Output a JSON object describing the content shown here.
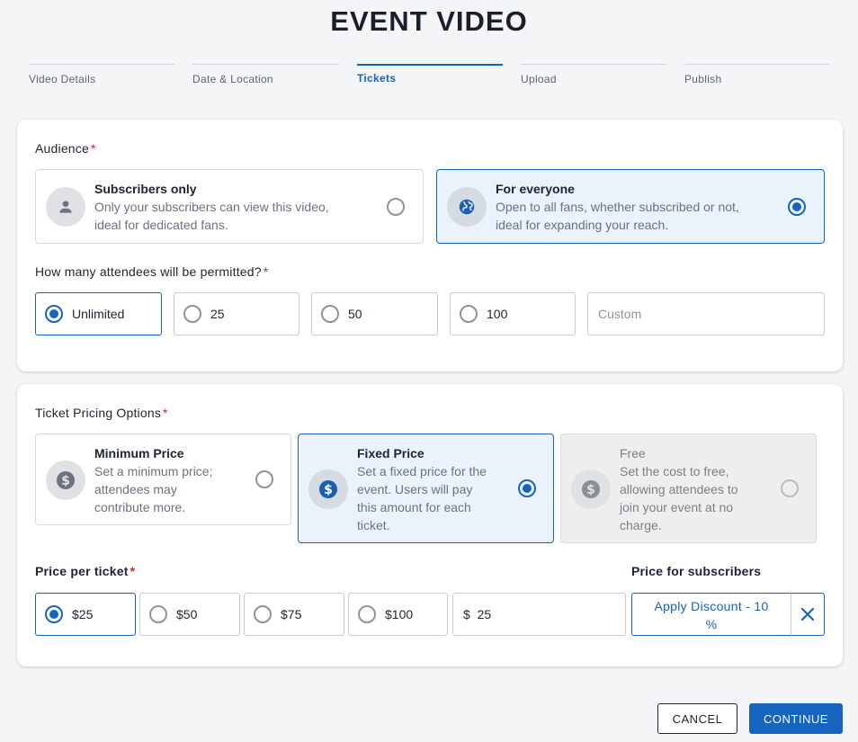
{
  "page": {
    "title": "EVENT VIDEO"
  },
  "steps": [
    {
      "label": "Video Details",
      "active": false
    },
    {
      "label": "Date & Location",
      "active": false
    },
    {
      "label": "Tickets",
      "active": true
    },
    {
      "label": "Upload",
      "active": false
    },
    {
      "label": "Publish",
      "active": false
    }
  ],
  "audience": {
    "label": "Audience",
    "required_mark": "*",
    "options": [
      {
        "title": "Subscribers only",
        "desc_line1": "Only your subscribers can view this video,",
        "desc_line2": "ideal for dedicated fans.",
        "icon": "person-icon",
        "selected": false
      },
      {
        "title": "For everyone",
        "desc_line1": "Open to all fans, whether subscribed or not,",
        "desc_line2": "ideal for expanding your reach.",
        "icon": "globe-icon",
        "selected": true
      }
    ]
  },
  "attendees": {
    "label": "How many attendees will be permitted?",
    "required_mark": "*",
    "options": [
      "Unlimited",
      "25",
      "50",
      "100"
    ],
    "selected": "Unlimited",
    "custom_placeholder": "Custom"
  },
  "pricing": {
    "label": "Ticket Pricing Options",
    "required_mark": "*",
    "options": [
      {
        "title": "Minimum Price",
        "desc_lines": [
          "Set a minimum price;",
          "attendees may",
          "contribute more."
        ],
        "icon": "dollar-icon",
        "selected": false,
        "disabled": false
      },
      {
        "title": "Fixed Price",
        "desc_lines": [
          "Set a fixed price for the",
          "event. Users will pay",
          "this amount for each",
          "ticket."
        ],
        "icon": "dollar-icon",
        "selected": true,
        "disabled": false
      },
      {
        "title": "Free",
        "desc_lines": [
          "Set the cost to free,",
          "allowing attendees to",
          "join your event at no",
          "charge."
        ],
        "icon": "dollar-icon",
        "selected": false,
        "disabled": true
      }
    ]
  },
  "price_per_ticket": {
    "label": "Price per ticket",
    "required_mark": "*",
    "options": [
      "$25",
      "$50",
      "$75",
      "$100"
    ],
    "selected": "$25",
    "custom_value": "$  25"
  },
  "subscriber_price": {
    "label": "Price for subscribers",
    "discount_line1": "Apply Discount - 10",
    "discount_line2": "%"
  },
  "actions": {
    "cancel": "CANCEL",
    "continue": "CONTINUE"
  },
  "colors": {
    "accent": "#1565c0",
    "required": "#c62828",
    "selected_bg": "#eaf2fc"
  }
}
